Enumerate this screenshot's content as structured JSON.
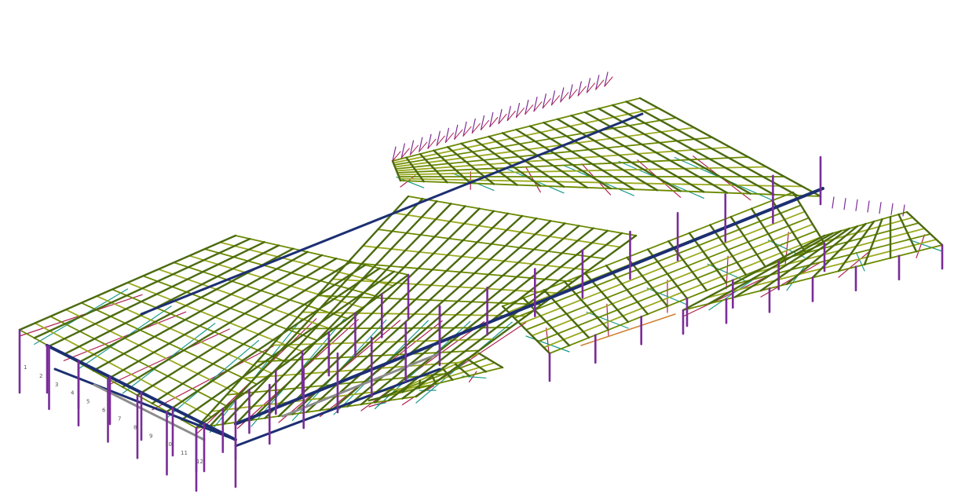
{
  "viewport": {
    "background": "#ffffff"
  },
  "model": {
    "colors": {
      "purlin": "#6b8a00",
      "purlin_light": "#9aaa1e",
      "rafter": "#4b6a10",
      "column": "#7a2c98",
      "main_beam": "#1c2f72",
      "bracing_teal": "#1a9a8a",
      "bracing_red": "#b02050",
      "grey_member": "#8c8c8c",
      "orange_member": "#d08030"
    },
    "grid_labels": [
      {
        "text": "1",
        "id": "gl-a1"
      },
      {
        "text": "2",
        "id": "gl-a2"
      },
      {
        "text": "3",
        "id": "gl-a3"
      },
      {
        "text": "4",
        "id": "gl-a4"
      },
      {
        "text": "5",
        "id": "gl-a5"
      },
      {
        "text": "6",
        "id": "gl-a6"
      },
      {
        "text": "7",
        "id": "gl-a7"
      },
      {
        "text": "8",
        "id": "gl-a8"
      },
      {
        "text": "9",
        "id": "gl-a9"
      },
      {
        "text": "10",
        "id": "gl-a10"
      },
      {
        "text": "11",
        "id": "gl-a11"
      },
      {
        "text": "12",
        "id": "gl-a12"
      }
    ]
  }
}
